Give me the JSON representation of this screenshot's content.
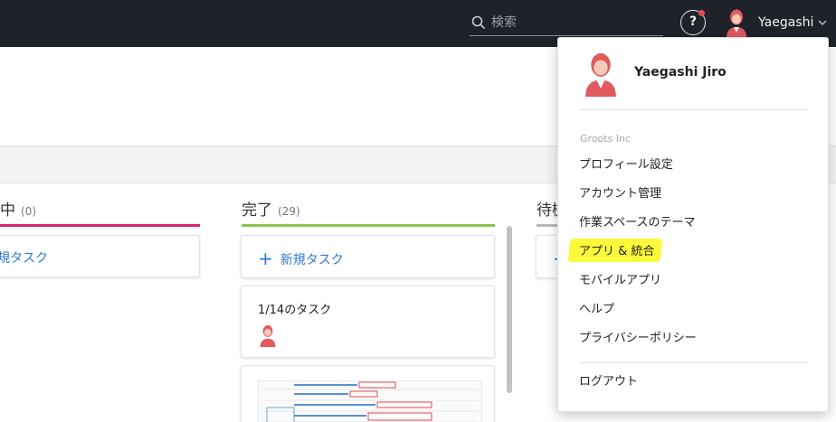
{
  "topbar": {
    "search_placeholder": "検索",
    "help_label": "?",
    "user_name": "Yaegashi"
  },
  "board": {
    "columns": [
      {
        "title": "中",
        "count": "(0)",
        "accent": "#d6246e",
        "new_task_label": "規タスク"
      },
      {
        "title": "完了",
        "count": "(29)",
        "accent": "#8bc34a",
        "new_task_label": "新規タスク"
      },
      {
        "title": "待機",
        "accent": "#b9b9b9"
      }
    ],
    "cards": [
      {
        "title": "1/14のタスク"
      }
    ]
  },
  "user_menu": {
    "full_name": "Yaegashi Jiro",
    "organization": "Groots Inc",
    "items": [
      "プロフィール設定",
      "アカウント管理",
      "作業スペースのテーマ",
      "アプリ & 統合",
      "モバイルアプリ",
      "ヘルプ",
      "プライバシーポリシー"
    ],
    "logout": "ログアウト",
    "highlight_color": "#fcf93a"
  },
  "colors": {
    "topbar_bg": "#1f2229",
    "link_blue": "#2e7ad1",
    "avatar_red": "#e05a60"
  }
}
